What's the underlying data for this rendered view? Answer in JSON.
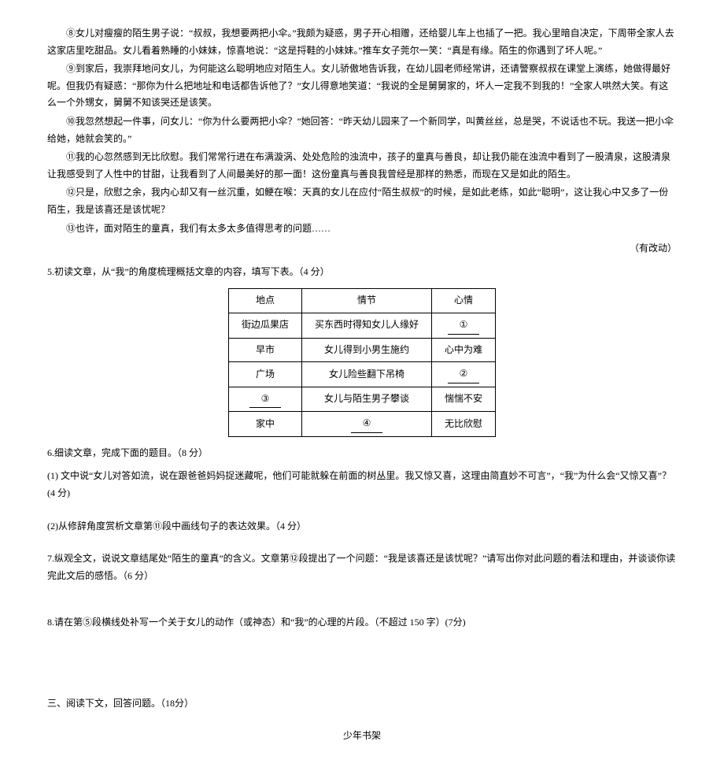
{
  "paragraphs": {
    "p8": "⑧女儿对瘦瘦的陌生男子说：“叔叔，我想要两把小伞。”我颇为疑惑，男子开心相赠，还给婴儿车上也插了一把。我心里暗自决定，下周带全家人去这家店里吃甜品。女儿看着熟睡的小妹妹，惊喜地说：“这是捋鞋的小妹妹。”推车女子莞尔一笑：“真是有缘。陌生的你遇到了坏人呢。”",
    "p9": "⑨到家后，我崇拜地问女儿，为何能这么聪明地应对陌生人。女儿骄傲地告诉我，在幼儿园老师经常讲，还请警察叔叔在课堂上演练，她做得最好呢。但我仍有疑惑：“那你为什么把地址和电话都告诉他了？”女儿得意地笑道：“我说的全是舅舅家的，坏人一定我不到我的！”全家人哄然大笑。有这么一个外甥女，舅舅不知该哭还是该笑。",
    "p10": "⑩我忽然想起一件事，问女儿：“你为什么要两把小伞？”她回答：“昨天幼儿园来了一个新同学，叫黄丝丝，总是哭，不说话也不玩。我送一把小伞给她，她就会笑的。”",
    "p11": "⑪我的心忽然感到无比欣慰。我们常常行进在布满漩涡、处处危险的浊流中，孩子的童真与善良，却让我仍能在浊流中看到了一股清泉，这股清泉让我感受到了人性中的甘甜，让我看到了人间最美好的那一面！这份童真与善良我曾经是那样的熟悉，而现在又是如此的陌生。",
    "p12": "⑫只是，欣慰之余，我内心却又有一丝沉重，如鲠在喉：天真的女儿在应付“陌生叔叔”的时候，是如此老练，如此“聪明”，这让我心中又多了一份陌生，我是该喜还是该忧呢？",
    "p13": "⑬也许，面对陌生的童真，我们有太多太多值得思考的问题……"
  },
  "right_note": "（有改动）",
  "questions": {
    "q5": "5.初读文章，从“我”的角度梳理概括文章的内容，填写下表。（4 分）",
    "q6": "6.细读文章，完成下面的题目。（8 分）",
    "q6_1": "(1) 文中说“女儿对答如流，说在跟爸爸妈妈捉迷藏呢，他们可能就躲在前面的树丛里。我又惊又喜，这理由简直妙不可言”，“我”为什么会“又惊又喜”？(4 分)",
    "q6_2": "(2)从修辞角度赏析文章第⑪段中画线句子的表达效果。（4 分）",
    "q7": "7.纵观全文，说说文章结尾处“陌生的童真”的含义。文章第⑫段提出了一个问题：“我是该喜还是该忧呢？”请写出你对此问题的看法和理由，并谈谈你读完此文后的感悟。（6 分）",
    "q8": "8.请在第⑤段横线处补写一个关于女儿的动作（或神态）和“我”的心理的片段。（不超过 150 字）(7分)"
  },
  "table": {
    "headers": [
      "地点",
      "情节",
      "心情"
    ],
    "rows": [
      {
        "c1": "街边瓜果店",
        "c2": "买东西时得知女儿人缘好",
        "c3": "①"
      },
      {
        "c1": "早市",
        "c2": "女儿得到小男生施约",
        "c3": "心中为难"
      },
      {
        "c1": "广场",
        "c2": "女儿险些翻下吊椅",
        "c3": "②"
      },
      {
        "c1": "③",
        "c2": "女儿与陌生男子攀谈",
        "c3": "惴惴不安"
      },
      {
        "c1": "家中",
        "c2": "④",
        "c3": "无比欣慰"
      }
    ]
  },
  "section3": "三、阅读下文，回答问题。（18分）",
  "footer_title": "少年书架"
}
